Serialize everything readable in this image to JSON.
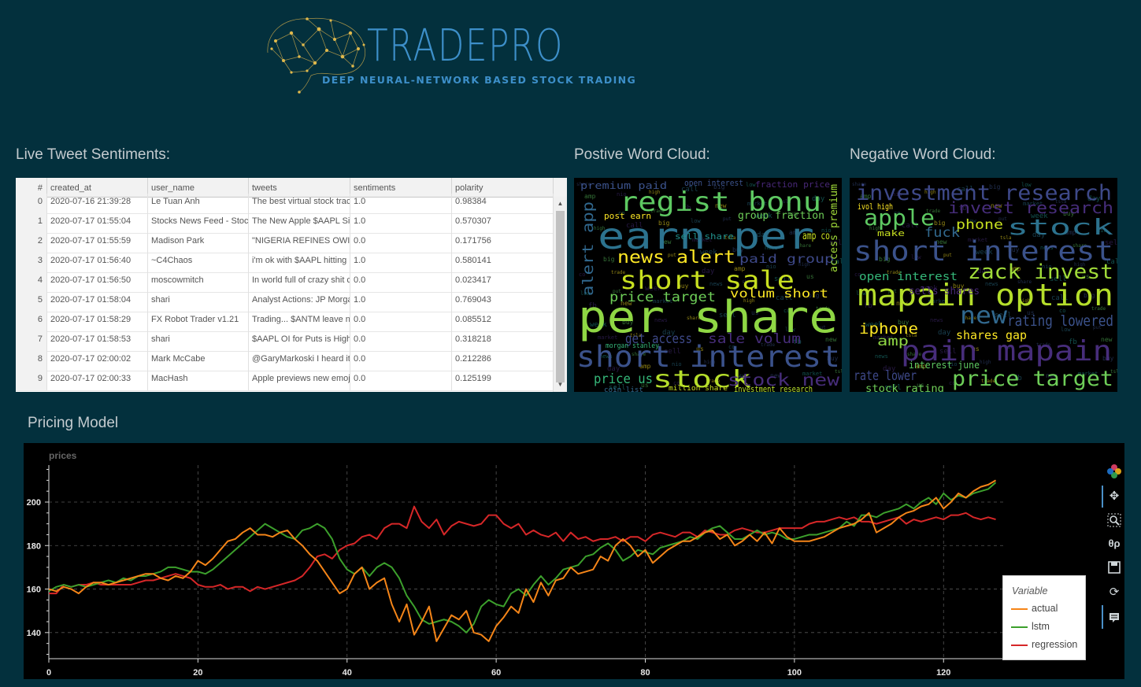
{
  "brand": {
    "name": "TRADEPRO",
    "tagline": "DEEP NEURAL-NETWORK BASED STOCK TRADING",
    "logo_icon": "brain-network-icon"
  },
  "tweets_section": {
    "title": "Live Tweet Sentiments:",
    "columns": [
      "#",
      "created_at",
      "user_name",
      "tweets",
      "sentiments",
      "polarity"
    ],
    "rows": [
      {
        "idx": "0",
        "created_at": "2020-07-16 21:39:28",
        "user_name": "Le Tuan Anh",
        "tweets": "The best virtual stock trac",
        "sentiments": "1.0",
        "polarity": "0.98384"
      },
      {
        "idx": "1",
        "created_at": "2020-07-17 01:55:04",
        "user_name": "Stocks News Feed - Stoc",
        "tweets": "The New Apple $AAPL Si",
        "sentiments": "1.0",
        "polarity": "0.570307"
      },
      {
        "idx": "2",
        "created_at": "2020-07-17 01:55:59",
        "user_name": "Madison Park",
        "tweets": "\"NIGERIA REFINES OWI",
        "sentiments": "0.0",
        "polarity": "0.171756"
      },
      {
        "idx": "3",
        "created_at": "2020-07-17 01:56:40",
        "user_name": "~C4Chaos",
        "tweets": "i'm ok with $AAPL hitting",
        "sentiments": "1.0",
        "polarity": "0.580141"
      },
      {
        "idx": "4",
        "created_at": "2020-07-17 01:56:50",
        "user_name": "moscowmitch",
        "tweets": "In world full of crazy shit c",
        "sentiments": "0.0",
        "polarity": "0.023417"
      },
      {
        "idx": "5",
        "created_at": "2020-07-17 01:58:04",
        "user_name": "shari",
        "tweets": "Analyst Actions: JP Morga",
        "sentiments": "1.0",
        "polarity": "0.769043"
      },
      {
        "idx": "6",
        "created_at": "2020-07-17 01:58:29",
        "user_name": "FX Robot Trader v1.21",
        "tweets": "Trading... $ANTM leave n",
        "sentiments": "0.0",
        "polarity": "0.085512"
      },
      {
        "idx": "7",
        "created_at": "2020-07-17 01:58:53",
        "user_name": "shari",
        "tweets": "$AAPL OI for Puts is High",
        "sentiments": "0.0",
        "polarity": "0.318218"
      },
      {
        "idx": "8",
        "created_at": "2020-07-17 02:00:02",
        "user_name": "Mark McCabe",
        "tweets": "@GaryMarkoski I heard it",
        "sentiments": "0.0",
        "polarity": "0.212286"
      },
      {
        "idx": "9",
        "created_at": "2020-07-17 02:00:33",
        "user_name": "MacHash",
        "tweets": "Apple previews new emoj",
        "sentiments": "0.0",
        "polarity": "0.125199"
      }
    ]
  },
  "positive_cloud": {
    "title": "Postive Word Cloud:",
    "words": [
      {
        "t": "per share",
        "c": "#8fd744"
      },
      {
        "t": "earn per",
        "c": "#2c728e"
      },
      {
        "t": "regist bonu",
        "c": "#5ec962"
      },
      {
        "t": "short interest",
        "c": "#3b528b"
      },
      {
        "t": "short sale",
        "c": "#c8e020"
      },
      {
        "t": "news alert",
        "c": "#fde725"
      },
      {
        "t": "stock",
        "c": "#b5de2b"
      },
      {
        "t": "stock new",
        "c": "#472d7b"
      },
      {
        "t": "price target",
        "c": "#6ece58"
      },
      {
        "t": "alert app",
        "c": "#31688e"
      },
      {
        "t": "paid group",
        "c": "#3e4989"
      },
      {
        "t": "volum short",
        "c": "#fde725"
      },
      {
        "t": "price us",
        "c": "#35b779"
      },
      {
        "t": "get access",
        "c": "#3e4989"
      },
      {
        "t": "sale volum",
        "c": "#472d7b"
      },
      {
        "t": "premium paid",
        "c": "#3b528b"
      },
      {
        "t": "post earn",
        "c": "#fde725"
      },
      {
        "t": "group fraction",
        "c": "#6ece58"
      },
      {
        "t": "access premium",
        "c": "#a0da39"
      },
      {
        "t": "open interest",
        "c": "#3b528b"
      },
      {
        "t": "fraction price",
        "c": "#482878"
      },
      {
        "t": "sell share",
        "c": "#21918c"
      },
      {
        "t": "amp co",
        "c": "#c8e020"
      },
      {
        "t": "morgan stanley",
        "c": "#35b779"
      },
      {
        "t": "coin list",
        "c": "#31688e"
      },
      {
        "t": "investment research",
        "c": "#b5de2b"
      },
      {
        "t": "million share",
        "c": "#c8e020"
      }
    ]
  },
  "negative_cloud": {
    "title": "Negative Word Cloud:",
    "words": [
      {
        "t": "investment research",
        "c": "#3e4989"
      },
      {
        "t": "invest research",
        "c": "#472d7b"
      },
      {
        "t": "short interest",
        "c": "#3b528b"
      },
      {
        "t": "mapain option",
        "c": "#b5de2b"
      },
      {
        "t": "pain mapain",
        "c": "#472d7b"
      },
      {
        "t": "price target",
        "c": "#6ece58"
      },
      {
        "t": "apple",
        "c": "#5ec962"
      },
      {
        "t": "stock",
        "c": "#2c728e"
      },
      {
        "t": "zack invest",
        "c": "#a0da39"
      },
      {
        "t": "new",
        "c": "#31688e"
      },
      {
        "t": "iphone",
        "c": "#fde725"
      },
      {
        "t": "rating lowered",
        "c": "#3b528b"
      },
      {
        "t": "phone",
        "c": "#c8e020"
      },
      {
        "t": "open interest",
        "c": "#35b779"
      },
      {
        "t": "shares gap",
        "c": "#fde725"
      },
      {
        "t": "amp",
        "c": "#8fd744"
      },
      {
        "t": "sells shares",
        "c": "#482878"
      },
      {
        "t": "rate lower",
        "c": "#3e4989"
      },
      {
        "t": "stock rating",
        "c": "#6ece58"
      },
      {
        "t": "interest june",
        "c": "#5ec962"
      },
      {
        "t": "fuck",
        "c": "#31688e"
      },
      {
        "t": "ivol high",
        "c": "#fde725"
      },
      {
        "t": "make",
        "c": "#c8e020"
      }
    ]
  },
  "pricing": {
    "title": "Pricing Model"
  },
  "toolbar": {
    "icons": [
      "bokeh-logo-icon",
      "pan-icon",
      "box-zoom-icon",
      "wheel-zoom-icon",
      "save-icon",
      "reset-icon",
      "hover-icon"
    ]
  },
  "chart_data": {
    "type": "line",
    "ylabel": "prices",
    "xlim": [
      0,
      128
    ],
    "ylim": [
      128,
      217
    ],
    "x_ticks": [
      "0",
      "20",
      "40",
      "60",
      "80",
      "100",
      "120"
    ],
    "y_ticks": [
      "140",
      "160",
      "180",
      "200"
    ],
    "grid": true,
    "legend": {
      "title": "Variable",
      "position": "bottom-right"
    },
    "series": [
      {
        "name": "actual",
        "color": "#f58518",
        "values": [
          160,
          159,
          161,
          160,
          158,
          161,
          163,
          163,
          162,
          163,
          164,
          165,
          166,
          167,
          167,
          165,
          164,
          166,
          165,
          168,
          173,
          171,
          174,
          178,
          182,
          183,
          186,
          188,
          185,
          185,
          184,
          186,
          187,
          183,
          180,
          176,
          173,
          168,
          163,
          158,
          160,
          167,
          170,
          160,
          163,
          165,
          153,
          145,
          153,
          139,
          145,
          152,
          136,
          142,
          148,
          146,
          150,
          140,
          139,
          136,
          143,
          147,
          152,
          149,
          160,
          154,
          163,
          157,
          164,
          165,
          170,
          167,
          168,
          169,
          175,
          173,
          180,
          183,
          180,
          175,
          178,
          172,
          175,
          178,
          180,
          182,
          182,
          184,
          186,
          187,
          183,
          185,
          180,
          182,
          185,
          182,
          186,
          181,
          188,
          184,
          182,
          182,
          182,
          183,
          184,
          186,
          188,
          189,
          190,
          192,
          195,
          186,
          188,
          190,
          193,
          195,
          196,
          198,
          199,
          202,
          197,
          200,
          204,
          202,
          205,
          207,
          208,
          210
        ]
      },
      {
        "name": "lstm",
        "color": "#3ca02c",
        "values": [
          159,
          161,
          162,
          161,
          162,
          161,
          162,
          163,
          164,
          163,
          165,
          164,
          166,
          166,
          167,
          168,
          170,
          170,
          169,
          168,
          168,
          167,
          169,
          172,
          175,
          178,
          181,
          184,
          187,
          190,
          188,
          186,
          184,
          183,
          187,
          188,
          190,
          188,
          183,
          174,
          169,
          167,
          170,
          166,
          170,
          172,
          170,
          165,
          157,
          152,
          146,
          144,
          145,
          146,
          145,
          143,
          140,
          144,
          152,
          155,
          153,
          152,
          158,
          160,
          157,
          162,
          166,
          162,
          165,
          169,
          170,
          171,
          175,
          176,
          179,
          181,
          178,
          173,
          175,
          178,
          177,
          176,
          179,
          180,
          181,
          182,
          184,
          183,
          186,
          188,
          189,
          186,
          183,
          183,
          185,
          187,
          185,
          186,
          185,
          183,
          183,
          184,
          185,
          185,
          186,
          187,
          188,
          191,
          189,
          194,
          194,
          193,
          195,
          196,
          197,
          199,
          197,
          200,
          202,
          199,
          204,
          201,
          203,
          202,
          204,
          205,
          206,
          209
        ]
      },
      {
        "name": "regression",
        "color": "#d62728",
        "values": [
          158,
          158,
          162,
          161,
          162,
          162,
          163,
          162,
          162,
          162,
          162,
          162,
          163,
          164,
          164,
          165,
          166,
          167,
          166,
          165,
          162,
          161,
          161,
          162,
          160,
          161,
          161,
          159,
          161,
          160,
          161,
          162,
          163,
          164,
          166,
          170,
          175,
          176,
          174,
          178,
          180,
          181,
          184,
          185,
          183,
          188,
          190,
          190,
          188,
          198,
          191,
          188,
          192,
          185,
          189,
          191,
          190,
          189,
          190,
          194,
          194,
          190,
          188,
          190,
          185,
          187,
          185,
          184,
          186,
          182,
          186,
          183,
          184,
          182,
          183,
          183,
          184,
          182,
          184,
          184,
          182,
          185,
          186,
          185,
          184,
          186,
          186,
          184,
          187,
          186,
          185,
          185,
          187,
          188,
          187,
          186,
          186,
          187,
          188,
          188,
          188,
          188,
          190,
          191,
          191,
          192,
          193,
          192,
          193,
          191,
          191,
          190,
          191,
          192,
          193,
          190,
          192,
          191,
          192,
          193,
          192,
          194,
          194,
          195,
          193,
          192,
          193,
          192
        ]
      }
    ]
  }
}
